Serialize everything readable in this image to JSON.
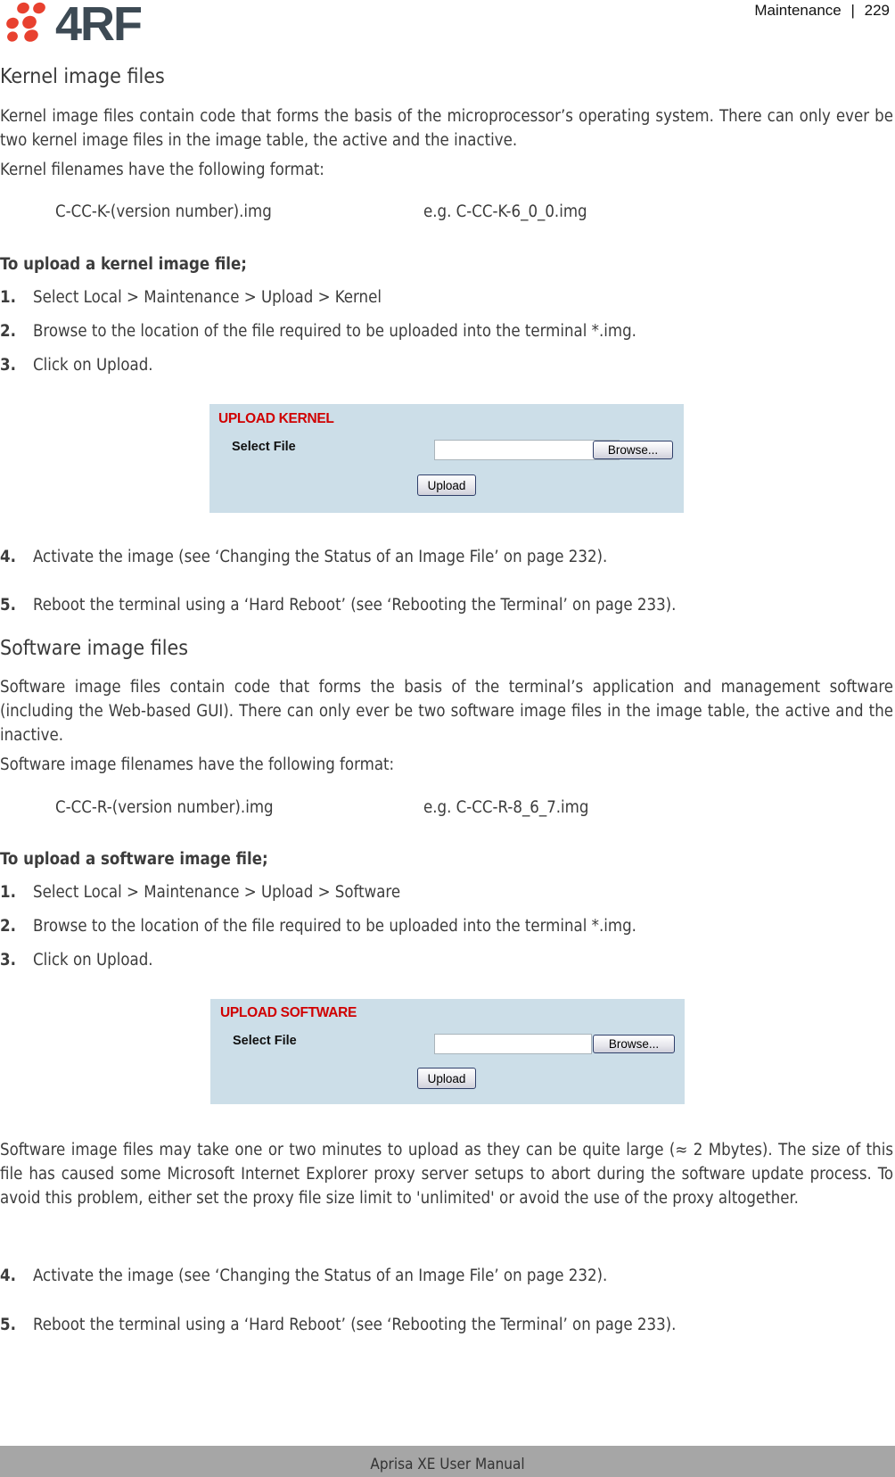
{
  "header": {
    "brand": "4RF",
    "section": "Maintenance",
    "separator": "|",
    "page_number": "229",
    "colors": {
      "logo_dots": "#e8412f",
      "logo_text": "#3d4a54"
    }
  },
  "kernel": {
    "heading": "Kernel image files",
    "intro": "Kernel image files contain code that forms the basis of the microprocessor’s operating system. There can only ever be two kernel image files in the image table, the active and the inactive.",
    "format_intro": "Kernel filenames have the following format:",
    "format": "C-CC-K-(version number).img",
    "example": "e.g. C-CC-K-6_0_0.img",
    "procedure_title": "To upload a kernel image file;",
    "steps": [
      {
        "num": "1.",
        "text": "Select Local > Maintenance > Upload > Kernel"
      },
      {
        "num": "2.",
        "text": "Browse to the location of the file required to be uploaded into the terminal *.img."
      },
      {
        "num": "3.",
        "text": "Click on Upload."
      }
    ],
    "panel": {
      "title": "UPLOAD KERNEL",
      "select_label": "Select File",
      "file_value": "",
      "browse_label": "Browse...",
      "upload_label": "Upload"
    },
    "post_steps": [
      {
        "num": "4.",
        "text": "Activate the image (see ‘Changing the Status of an Image File’ on page 232)."
      },
      {
        "num": "5.",
        "text": "Reboot the terminal using a ‘Hard Reboot’ (see ‘Rebooting the Terminal’ on page 233)."
      }
    ]
  },
  "software": {
    "heading": "Software image files",
    "intro": "Software image files contain code that forms the basis of the terminal’s application and management software (including the Web-based GUI). There can only ever be two software image files in the image table, the active and the inactive.",
    "format_intro": "Software image filenames have the following format:",
    "format": "C-CC-R-(version number).img",
    "example": "e.g. C-CC-R-8_6_7.img",
    "procedure_title": "To upload a software image file;",
    "steps": [
      {
        "num": "1.",
        "text": "Select Local > Maintenance > Upload > Software"
      },
      {
        "num": "2.",
        "text": "Browse to the location of the file required to be uploaded into the terminal *.img."
      },
      {
        "num": "3.",
        "text": "Click on Upload."
      }
    ],
    "panel": {
      "title": "UPLOAD SOFTWARE",
      "select_label": "Select File",
      "file_value": "",
      "browse_label": "Browse...",
      "upload_label": "Upload"
    },
    "note": "Software image files may take one or two minutes to upload as they can be quite large (≈ 2 Mbytes). The size of this file has caused some Microsoft Internet Explorer proxy server setups to abort during the software update process. To avoid this problem, either set the proxy file size limit to 'unlimited' or avoid the use of the proxy altogether.",
    "post_steps": [
      {
        "num": "4.",
        "text": "Activate the image (see ‘Changing the Status of an Image File’ on page 232)."
      },
      {
        "num": "5.",
        "text": "Reboot the terminal using a ‘Hard Reboot’ (see ‘Rebooting the Terminal’ on page 233)."
      }
    ]
  },
  "footer": {
    "text": "Aprisa XE User Manual"
  }
}
